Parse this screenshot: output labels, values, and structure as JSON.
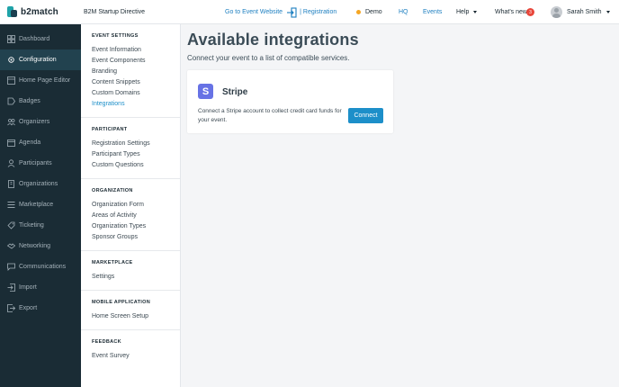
{
  "header": {
    "brand": "b2match",
    "event_title": "B2M Startup Directive",
    "go_to_event": "Go to Event Website",
    "registration": "Registration",
    "demo": "Demo",
    "hq": "HQ",
    "events": "Events",
    "help": "Help",
    "whats_new": "What's new",
    "whats_new_count": "3",
    "user_name": "Sarah Smith",
    "accent_color": "#1d7fc0"
  },
  "sidebar": {
    "items": [
      {
        "label": "Dashboard",
        "icon": "dashboard-icon"
      },
      {
        "label": "Configuration",
        "icon": "gear-icon",
        "active": true
      },
      {
        "label": "Home Page Editor",
        "icon": "page-editor-icon"
      },
      {
        "label": "Badges",
        "icon": "badge-icon"
      },
      {
        "label": "Organizers",
        "icon": "organizers-icon"
      },
      {
        "label": "Agenda",
        "icon": "calendar-icon"
      },
      {
        "label": "Participants",
        "icon": "participants-icon"
      },
      {
        "label": "Organizations",
        "icon": "building-icon"
      },
      {
        "label": "Marketplace",
        "icon": "marketplace-icon"
      },
      {
        "label": "Ticketing",
        "icon": "ticket-icon"
      },
      {
        "label": "Networking",
        "icon": "handshake-icon"
      },
      {
        "label": "Communications",
        "icon": "chat-icon"
      },
      {
        "label": "Import",
        "icon": "import-icon"
      },
      {
        "label": "Export",
        "icon": "export-icon"
      }
    ]
  },
  "submenu": {
    "sections": [
      {
        "heading": "EVENT SETTINGS",
        "links": [
          "Event Information",
          "Event Components",
          "Branding",
          "Content Snippets",
          "Custom Domains",
          "Integrations"
        ],
        "active": "Integrations"
      },
      {
        "heading": "PARTICIPANT",
        "links": [
          "Registration Settings",
          "Participant Types",
          "Custom Questions"
        ]
      },
      {
        "heading": "ORGANIZATION",
        "links": [
          "Organization Form",
          "Areas of Activity",
          "Organization Types",
          "Sponsor Groups"
        ]
      },
      {
        "heading": "MARKETPLACE",
        "links": [
          "Settings"
        ]
      },
      {
        "heading": "MOBILE APPLICATION",
        "links": [
          "Home Screen Setup"
        ]
      },
      {
        "heading": "FEEDBACK",
        "links": [
          "Event Survey"
        ]
      }
    ]
  },
  "main": {
    "title": "Available integrations",
    "subtitle": "Connect your event to a list of compatible services.",
    "integrations": [
      {
        "name": "Stripe",
        "logo_letter": "S",
        "logo_color": "#6772e5",
        "description": "Connect a Stripe account to collect credit card funds for your event.",
        "button_label": "Connect"
      }
    ]
  }
}
